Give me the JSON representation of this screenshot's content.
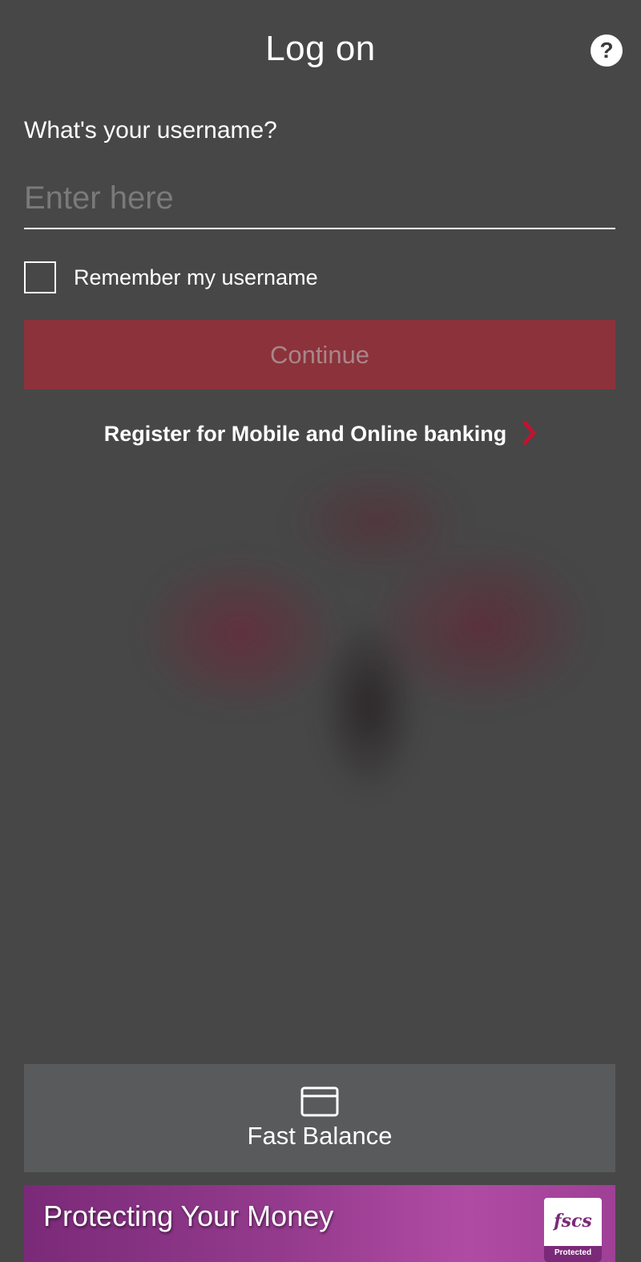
{
  "header": {
    "title": "Log on",
    "help_icon": "question-mark-icon",
    "help_glyph": "?"
  },
  "login_form": {
    "username_label": "What's your username?",
    "username_value": "",
    "username_placeholder": "Enter here",
    "remember_label": "Remember my username",
    "remember_checked": false,
    "continue_label": "Continue",
    "continue_enabled": false
  },
  "register": {
    "label": "Register for Mobile and Online banking",
    "icon": "chevron-right-icon"
  },
  "fast_balance": {
    "label": "Fast Balance",
    "icon": "card-icon"
  },
  "banner": {
    "title": "Protecting Your Money",
    "logo_text": "fscs",
    "logo_badge": "Protected"
  },
  "colors": {
    "background": "#474747",
    "continue_button": "#8c323a",
    "chevron": "#c8102e",
    "fast_balance_bg": "#595a5b",
    "banner_purple": "#953b8e"
  }
}
